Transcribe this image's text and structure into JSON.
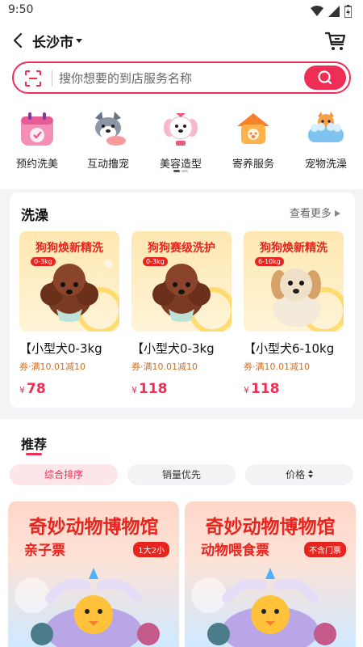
{
  "status": {
    "time": "9:50"
  },
  "header": {
    "city": "长沙市"
  },
  "search": {
    "placeholder": "搜你想要的到店服务名称"
  },
  "categories": [
    {
      "label": "预约洗美",
      "icon": "calendar-icon"
    },
    {
      "label": "互动撸宠",
      "icon": "dog-hand-icon"
    },
    {
      "label": "美容造型",
      "icon": "grooming-dog-icon"
    },
    {
      "label": "寄养服务",
      "icon": "pet-house-icon"
    },
    {
      "label": "宠物洗澡",
      "icon": "bathtub-cat-icon"
    }
  ],
  "wash": {
    "title": "洗澡",
    "more": "查看更多",
    "cards": [
      {
        "headline": "狗狗焕新精洗",
        "tag": "0-3kg",
        "name": "【小型犬0-3kg",
        "coupon": "券·满10.01减10",
        "price": "78",
        "currency": "¥"
      },
      {
        "headline": "狗狗赛级洗护",
        "tag": "0-3kg",
        "name": "【小型犬0-3kg",
        "coupon": "券·满10.01减10",
        "price": "118",
        "currency": "¥"
      },
      {
        "headline": "狗狗焕新精洗",
        "tag": "6-10kg",
        "name": "【小型犬6-10kg",
        "coupon": "券·满10.01减10",
        "price": "118",
        "currency": "¥"
      }
    ]
  },
  "recommend": {
    "title": "推荐",
    "tabs": [
      "综合排序",
      "销量优先",
      "价格"
    ],
    "products": [
      {
        "title": "奇妙动物博物馆",
        "subtitle": "亲子票",
        "badge": "1大2小"
      },
      {
        "title": "奇妙动物博物馆",
        "subtitle": "动物喂食票",
        "badge": "不含门票"
      }
    ]
  },
  "colors": {
    "accent": "#ef2e55",
    "promo": "#e8241f",
    "coupon": "#c8722a"
  }
}
